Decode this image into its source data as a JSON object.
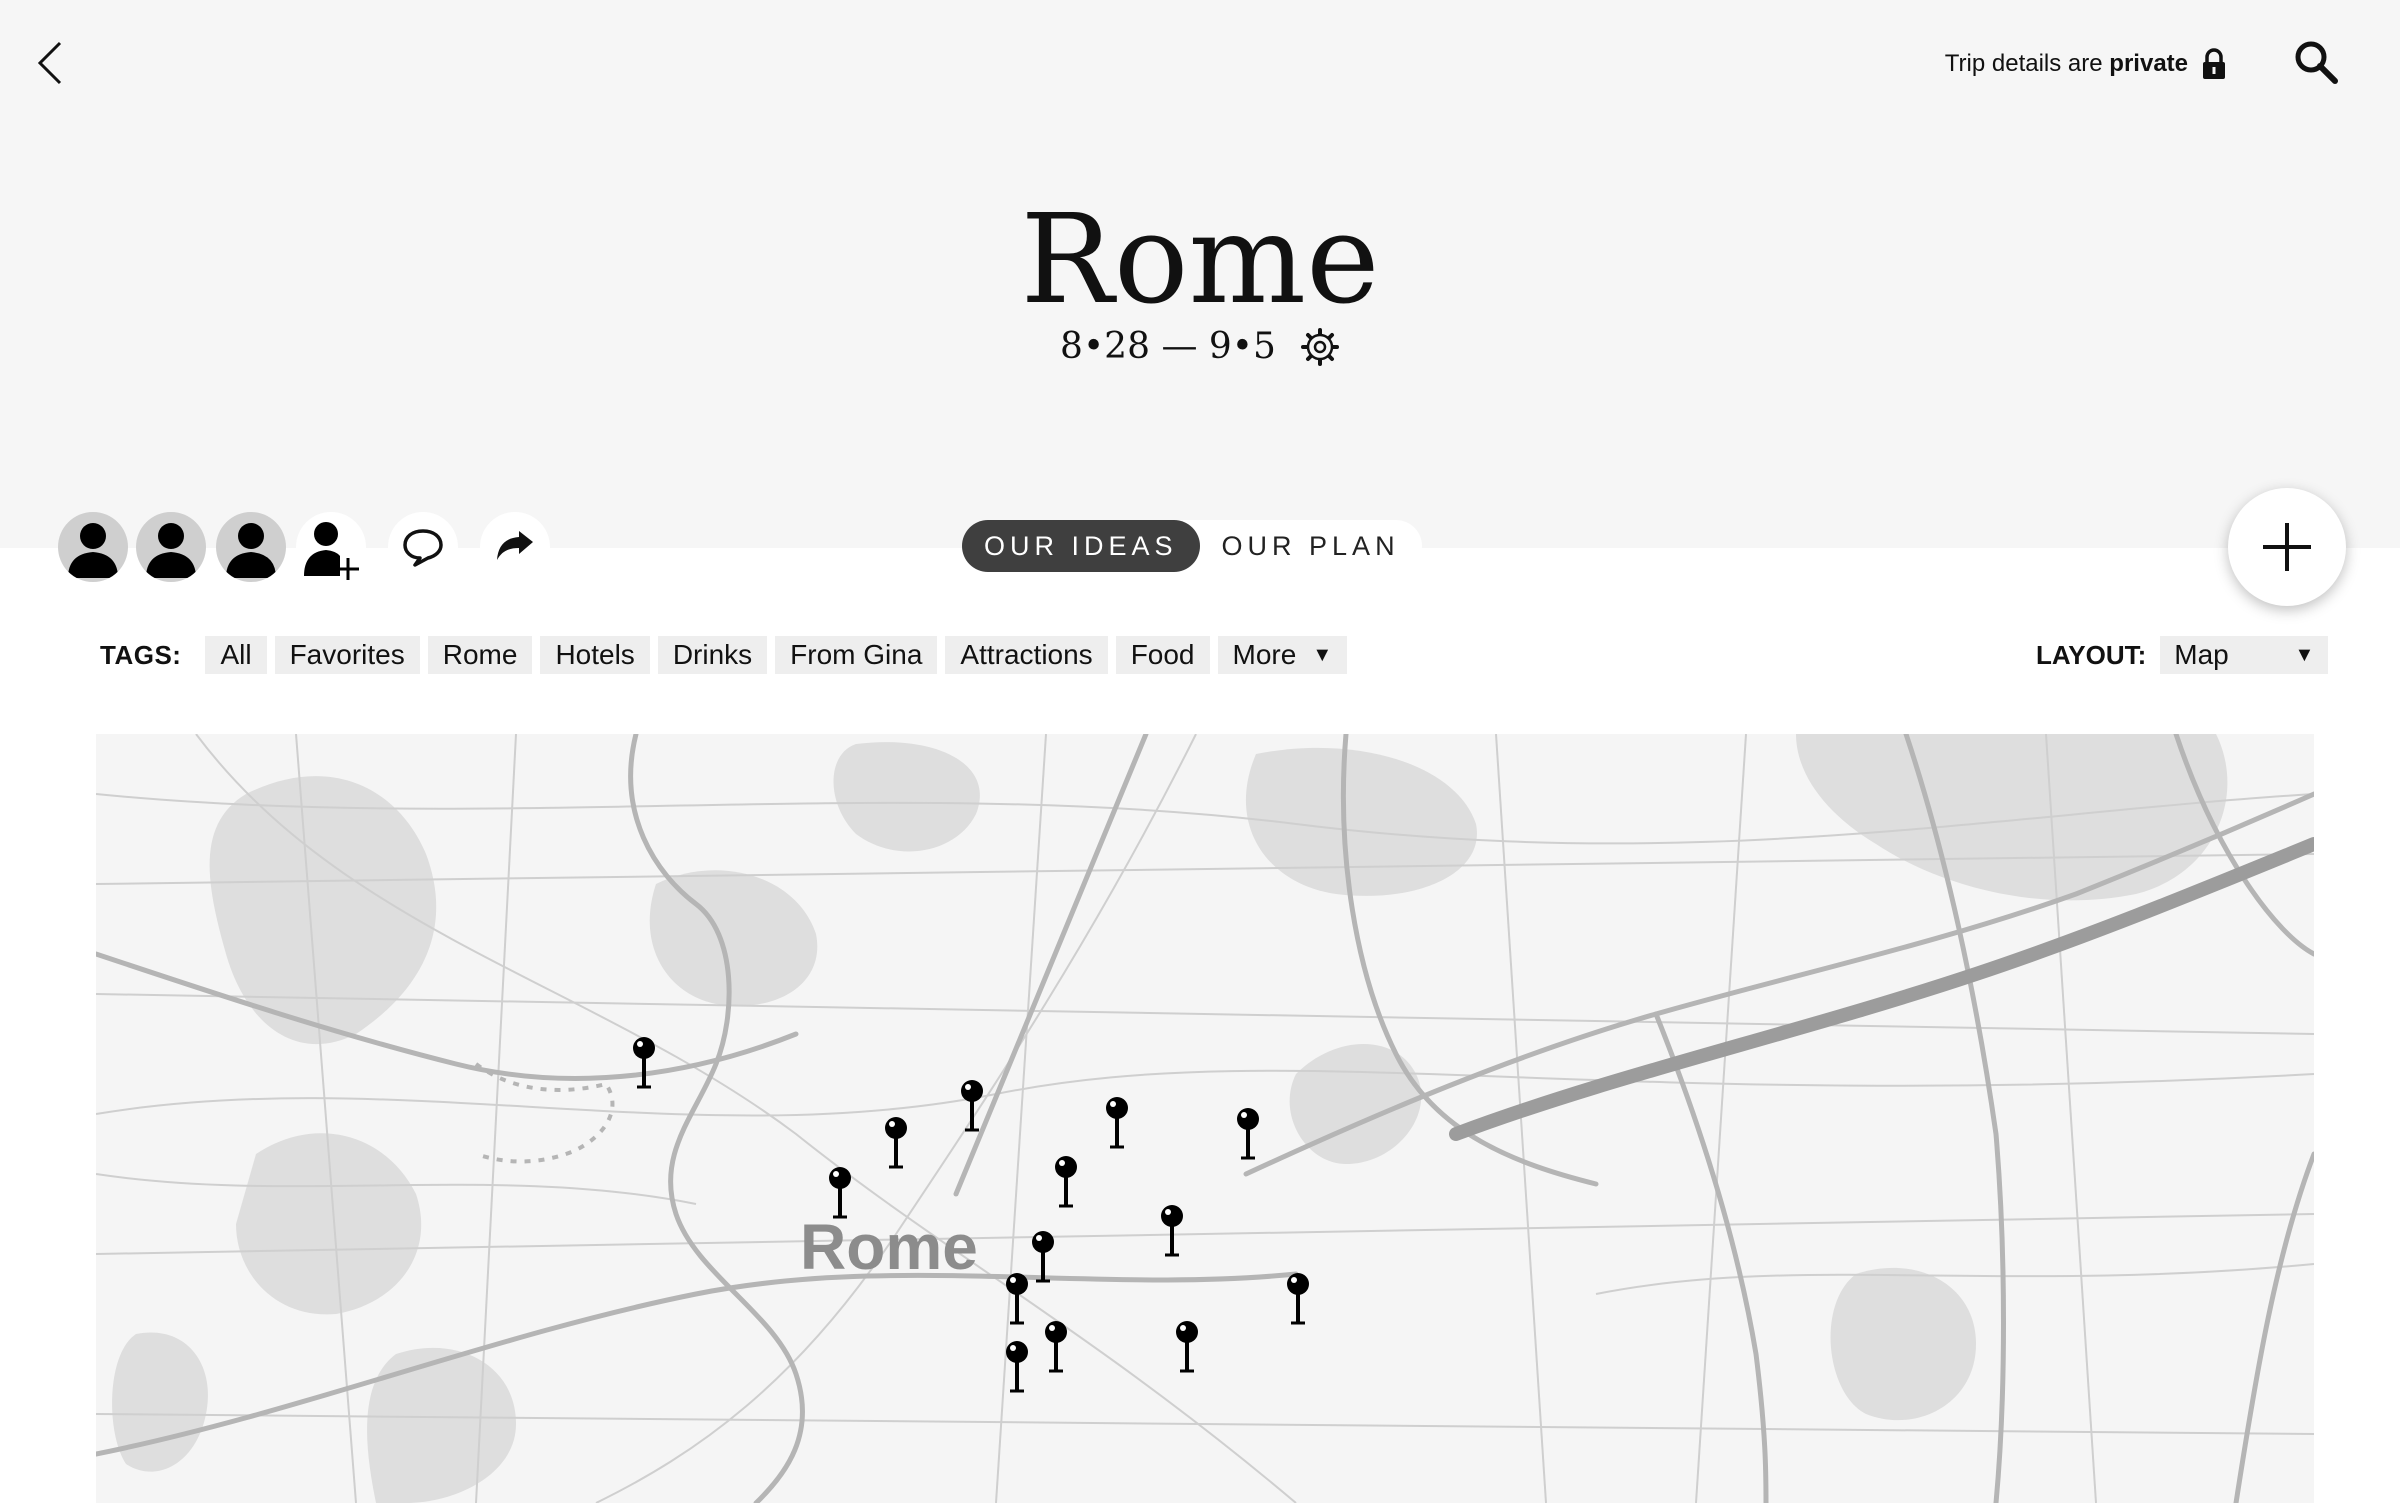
{
  "header": {
    "title": "Rome",
    "dates": "8•28 — 9•5",
    "privacy_prefix": "Trip details are",
    "privacy_emphasis": "private"
  },
  "members": {
    "avatar_count": 3
  },
  "tabs": {
    "ideas_label": "OUR IDEAS",
    "plan_label": "OUR PLAN",
    "active": "ideas"
  },
  "tags": {
    "label": "TAGS:",
    "items": [
      "All",
      "Favorites",
      "Rome",
      "Hotels",
      "Drinks",
      "From Gina",
      "Attractions",
      "Food"
    ],
    "more_label": "More"
  },
  "layout": {
    "label": "LAYOUT:",
    "value": "Map"
  },
  "map": {
    "city_label": "Rome",
    "pin_count": 14
  },
  "icons": {
    "back": "chevron-left-icon",
    "privacy": "lock-icon",
    "search": "search-icon",
    "settings": "gear-icon",
    "add_member": "add-person-icon",
    "chat": "chat-bubble-icon",
    "share": "share-arrow-icon",
    "add": "plus-icon",
    "dropdown": "caret-down-icon"
  },
  "colors": {
    "header_bg": "#f6f6f6",
    "active_tab": "#3f3f3f",
    "tag_bg": "#eeeeee",
    "map_road": "#bdbdbd",
    "map_park": "#dedede",
    "pin": "#000000"
  }
}
